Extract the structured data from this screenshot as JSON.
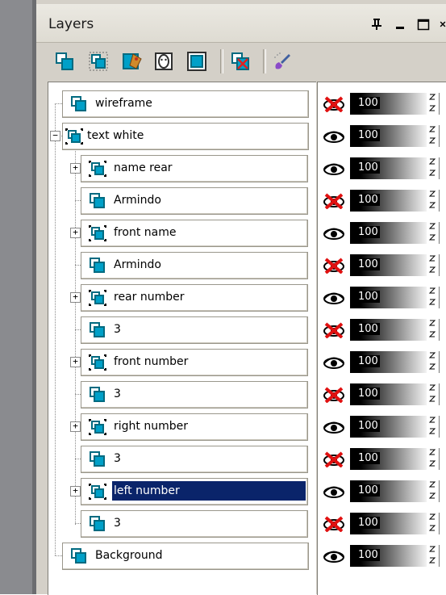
{
  "panel": {
    "title": "Layers",
    "window_controls": [
      {
        "name": "pin-icon",
        "glyph": "pin"
      },
      {
        "name": "minimize-icon",
        "glyph": "minimize"
      },
      {
        "name": "maximize-icon",
        "glyph": "maximize"
      },
      {
        "name": "close-icon",
        "glyph": "close"
      }
    ]
  },
  "toolbar": {
    "tools": [
      {
        "name": "new-layer-icon"
      },
      {
        "name": "new-group-icon"
      },
      {
        "name": "layer-properties-icon"
      },
      {
        "name": "mask-icon"
      },
      {
        "name": "merge-layers-icon"
      },
      {
        "name": "delete-layer-icon"
      },
      {
        "name": "brush-icon"
      }
    ]
  },
  "colors": {
    "selection": "#0a246a",
    "panel_bg": "#d4d0c8",
    "layer_icon": "#00a0c8"
  },
  "layers": [
    {
      "label": "wireframe",
      "visible": false,
      "opacity": "100"
    },
    {
      "label": "text white",
      "visible": true,
      "opacity": "100"
    },
    {
      "label": "name rear",
      "visible": true,
      "opacity": "100"
    },
    {
      "label": "Armindo",
      "visible": false,
      "opacity": "100"
    },
    {
      "label": "front name",
      "visible": true,
      "opacity": "100"
    },
    {
      "label": "Armindo",
      "visible": false,
      "opacity": "100"
    },
    {
      "label": "rear number",
      "visible": true,
      "opacity": "100"
    },
    {
      "label": "3",
      "visible": false,
      "opacity": "100"
    },
    {
      "label": "front number",
      "visible": true,
      "opacity": "100"
    },
    {
      "label": "3",
      "visible": false,
      "opacity": "100"
    },
    {
      "label": "right number",
      "visible": true,
      "opacity": "100"
    },
    {
      "label": "3",
      "visible": false,
      "opacity": "100"
    },
    {
      "label": "left number",
      "visible": true,
      "opacity": "100",
      "selected": true
    },
    {
      "label": "3",
      "visible": false,
      "opacity": "100"
    },
    {
      "label": "Background",
      "visible": true,
      "opacity": "100"
    }
  ]
}
